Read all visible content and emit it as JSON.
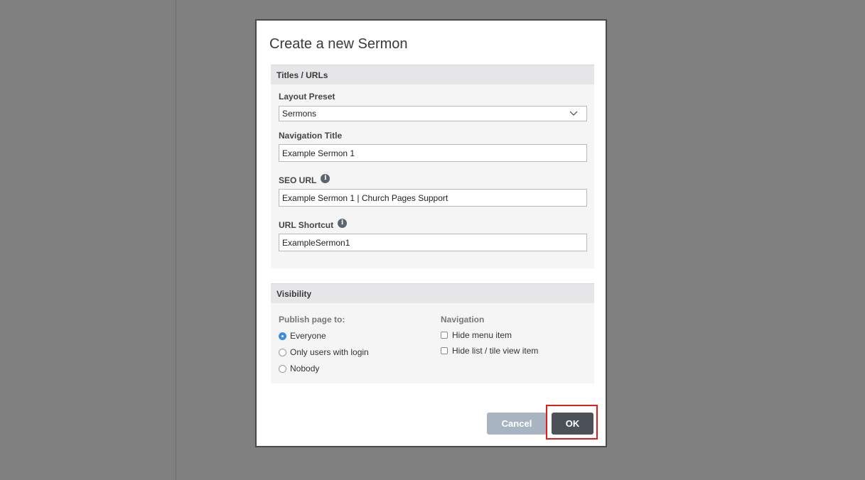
{
  "dialog": {
    "title": "Create a new Sermon"
  },
  "titles_section": {
    "header": "Titles / URLs",
    "layout_preset": {
      "label": "Layout Preset",
      "selected": "Sermons"
    },
    "navigation_title": {
      "label": "Navigation Title",
      "value": "Example Sermon 1"
    },
    "seo_url": {
      "label": "SEO URL",
      "value": "Example Sermon 1 | Church Pages Support"
    },
    "url_shortcut": {
      "label": "URL Shortcut",
      "value": "ExampleSermon1"
    },
    "info_glyph": "i"
  },
  "visibility_section": {
    "header": "Visibility",
    "publish_label": "Publish page to:",
    "publish_options": [
      {
        "label": "Everyone",
        "checked": true
      },
      {
        "label": "Only users with login",
        "checked": false
      },
      {
        "label": "Nobody",
        "checked": false
      }
    ],
    "navigation_label": "Navigation",
    "navigation_options": [
      {
        "label": "Hide menu item",
        "checked": false
      },
      {
        "label": "Hide list / tile view item",
        "checked": false
      }
    ]
  },
  "buttons": {
    "cancel": "Cancel",
    "ok": "OK"
  },
  "colors": {
    "backdrop": "#808080",
    "accent_radio": "#3b8fe0",
    "ok_button": "#4b5157",
    "cancel_button": "#a9b4c3",
    "highlight": "#e21b1b"
  }
}
